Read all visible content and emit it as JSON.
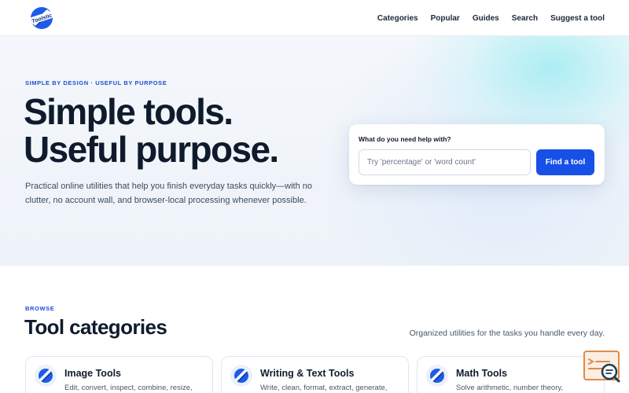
{
  "header": {
    "logo_alt": "Toolstic",
    "nav": [
      "Categories",
      "Popular",
      "Guides",
      "Search",
      "Suggest a tool"
    ]
  },
  "hero": {
    "eyebrow": "SIMPLE BY DESIGN · USEFUL BY PURPOSE",
    "title_line1": "Simple tools.",
    "title_line2": "Useful purpose.",
    "description": "Practical online utilities that help you finish everyday tasks quickly—with no clutter, no account wall, and browser-local processing whenever possible."
  },
  "search": {
    "label": "What do you need help with?",
    "placeholder": "Try 'percentage' or 'word count'",
    "value": "",
    "button": "Find a tool"
  },
  "browse": {
    "eyebrow": "BROWSE",
    "title": "Tool categories",
    "subtitle": "Organized utilities for the tasks you handle every day.",
    "categories": [
      {
        "title": "Image Tools",
        "description": "Edit, convert, inspect, combine, resize,",
        "icon": "globe-icon"
      },
      {
        "title": "Writing & Text Tools",
        "description": "Write, clean, format, extract, generate,",
        "icon": "globe-icon"
      },
      {
        "title": "Math Tools",
        "description": "Solve arithmetic, number theory,",
        "icon": "globe-icon"
      }
    ]
  },
  "widget": {
    "icon": "search-document-icon"
  },
  "colors": {
    "accent": "#1750e6",
    "eyebrow": "#1d4fd8",
    "text": "#0f1b2d"
  }
}
